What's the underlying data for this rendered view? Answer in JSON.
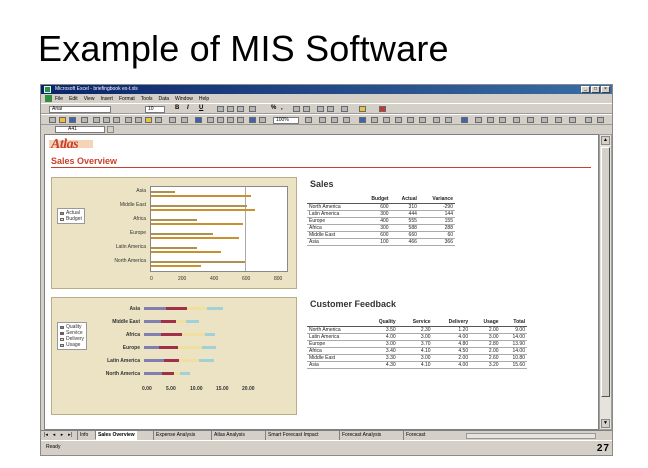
{
  "slide": {
    "title": "Example of MIS Software",
    "page_number": "27"
  },
  "window": {
    "title": "Microsoft Excel - briefingbook ex-t.xls",
    "controls": [
      "_",
      "□",
      "×"
    ]
  },
  "menu": [
    "File",
    "Edit",
    "View",
    "Insert",
    "Format",
    "Tools",
    "Data",
    "Window",
    "Help"
  ],
  "toolbar": {
    "font": "Arial",
    "size": "10",
    "bold": "B",
    "italic": "I",
    "underline": "U",
    "percent": "%",
    "comma": ",",
    "zoom": "100%"
  },
  "formula": {
    "cell": "A41"
  },
  "sheet": {
    "logo": "Atlas",
    "title": "Sales Overview",
    "sales_chart": {
      "categories": [
        "Asia",
        "Middle East",
        "Africa",
        "Europe",
        "Latin America",
        "North America"
      ],
      "ticks": [
        "0",
        "200",
        "400",
        "600",
        "800"
      ],
      "legend": [
        "Actual",
        "Budget"
      ],
      "colors": {
        "actual": "#c8902e",
        "budget": "#efdcb6"
      }
    },
    "feedback_chart": {
      "categories": [
        "Asia",
        "Middle East",
        "Africa",
        "Europe",
        "Latin America",
        "North America"
      ],
      "ticks": [
        "0.00",
        "5.00",
        "10.00",
        "15.00",
        "20.00"
      ],
      "legend": [
        "Quality",
        "Service",
        "Delivery",
        "Usage"
      ],
      "colors": {
        "quality": "#8080b0",
        "service": "#a0304a",
        "delivery": "#f0e0a0",
        "usage": "#a0d0d8"
      }
    },
    "sales_table": {
      "title": "Sales",
      "headers": [
        "",
        "Budget",
        "Actual",
        "Variance"
      ],
      "rows": [
        [
          "North America",
          "600",
          "310",
          "-290"
        ],
        [
          "Latin America",
          "300",
          "444",
          "144"
        ],
        [
          "Europe",
          "400",
          "555",
          "155"
        ],
        [
          "Africa",
          "300",
          "588",
          "288"
        ],
        [
          "Middle East",
          "600",
          "660",
          "60"
        ],
        [
          "Asia",
          "100",
          "466",
          "366"
        ]
      ]
    },
    "feedback_table": {
      "title": "Customer Feedback",
      "headers": [
        "",
        "Quality",
        "Service",
        "Delivery",
        "Usage",
        "Total"
      ],
      "rows": [
        [
          "North America",
          "3.50",
          "2.30",
          "1.20",
          "2.00",
          "9.00"
        ],
        [
          "Latin America",
          "4.00",
          "3.00",
          "4.00",
          "3.00",
          "14.00"
        ],
        [
          "Europe",
          "3.00",
          "3.70",
          "4.80",
          "2.80",
          "13.90"
        ],
        [
          "Africa",
          "3.40",
          "4.10",
          "4.50",
          "2.00",
          "14.00"
        ],
        [
          "Middle East",
          "3.30",
          "3.00",
          "2.00",
          "2.60",
          "10.80"
        ],
        [
          "Asia",
          "4.30",
          "4.10",
          "4.00",
          "3.20",
          "15.60"
        ]
      ]
    }
  },
  "tabs": [
    "Info",
    "Sales Overview",
    "Expense Analysis",
    "Atlas Analysis",
    "Smart Forecast Impact",
    "Forecast Analysis",
    "Forecast"
  ],
  "status": "Ready"
}
